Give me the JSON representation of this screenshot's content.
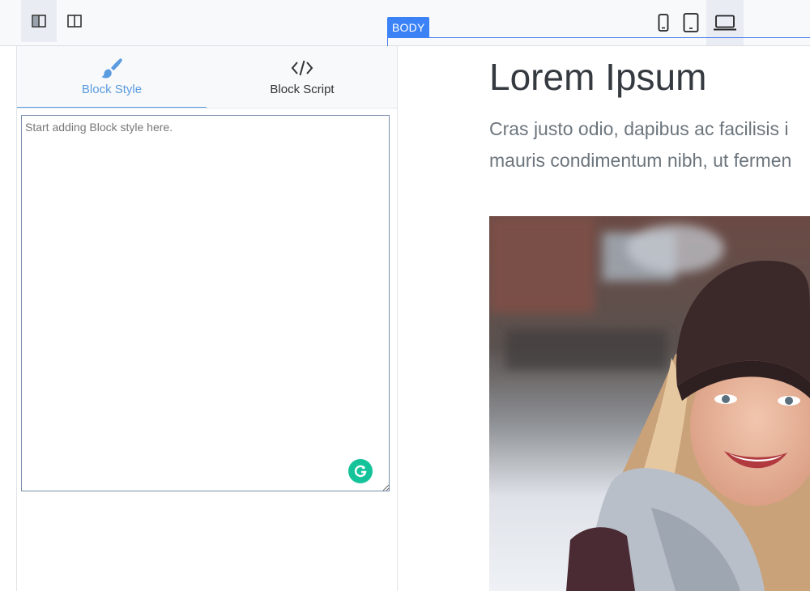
{
  "toolbar": {
    "layout_buttons": [
      {
        "name": "left-sidebar-layout",
        "active": true
      },
      {
        "name": "split-layout",
        "active": false
      }
    ],
    "devices": [
      {
        "name": "mobile",
        "active": false
      },
      {
        "name": "tablet",
        "active": false
      },
      {
        "name": "laptop",
        "active": true
      }
    ]
  },
  "selection": {
    "badge": "BODY",
    "color": "#3b82f6"
  },
  "panel": {
    "tabs": [
      {
        "label": "Block Style",
        "icon": "paintbrush-icon",
        "active": true
      },
      {
        "label": "Block Script",
        "icon": "code-icon",
        "active": false
      }
    ],
    "editor": {
      "value": "",
      "placeholder": "Start adding Block style here."
    },
    "accent": "#5b9be0"
  },
  "canvas": {
    "title": "Lorem Ipsum",
    "lead_lines": [
      "Cras justo odio, dapibus ac facilisis i",
      "mauris condimentum nibh, ut fermen"
    ],
    "image": "woman-in-beanie-photo"
  }
}
